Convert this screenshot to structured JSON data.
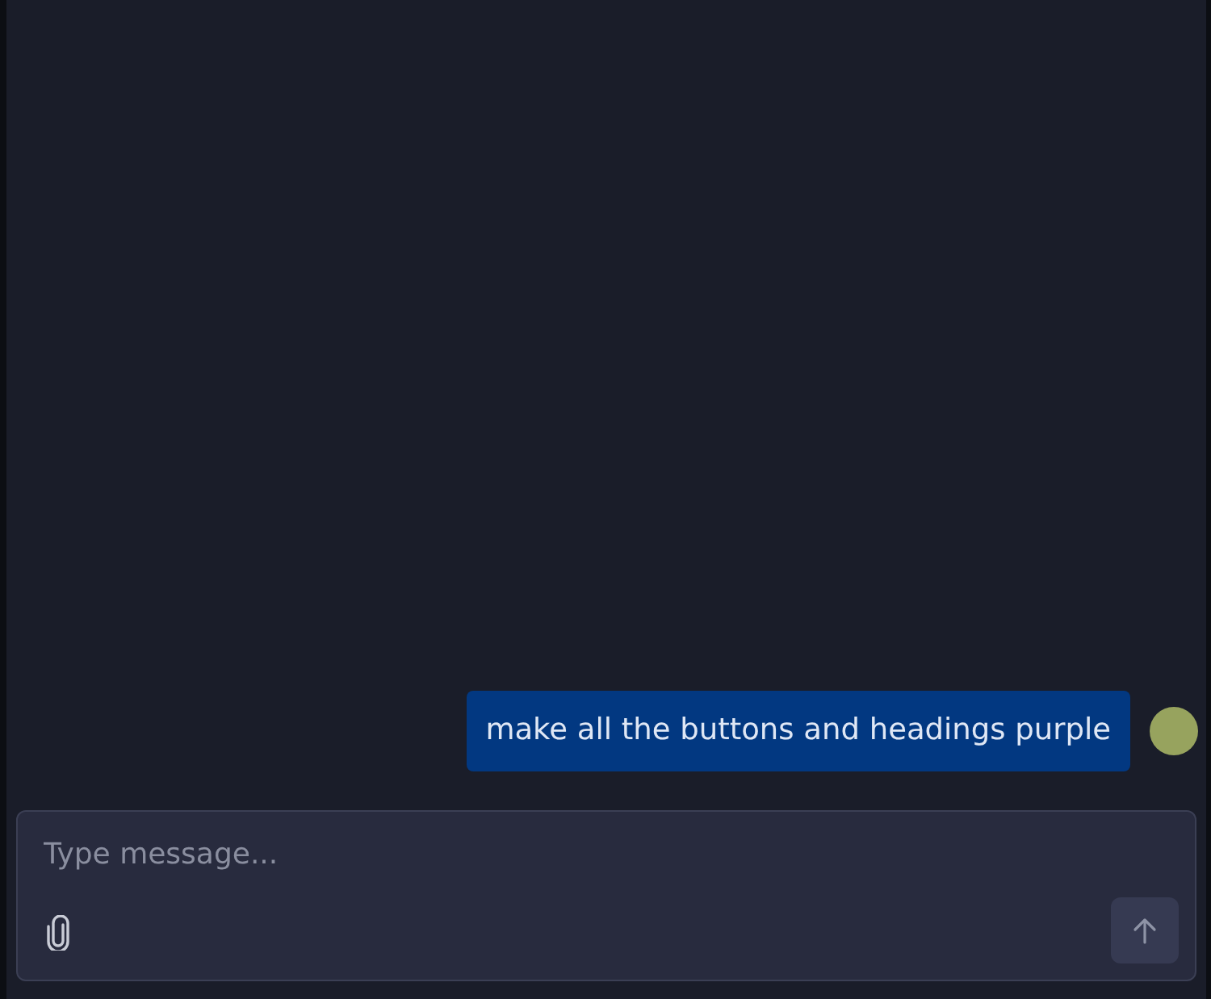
{
  "messages": [
    {
      "kind": "user",
      "text": "make all the buttons and headings purple"
    }
  ],
  "composer": {
    "placeholder": "Type message..."
  }
}
